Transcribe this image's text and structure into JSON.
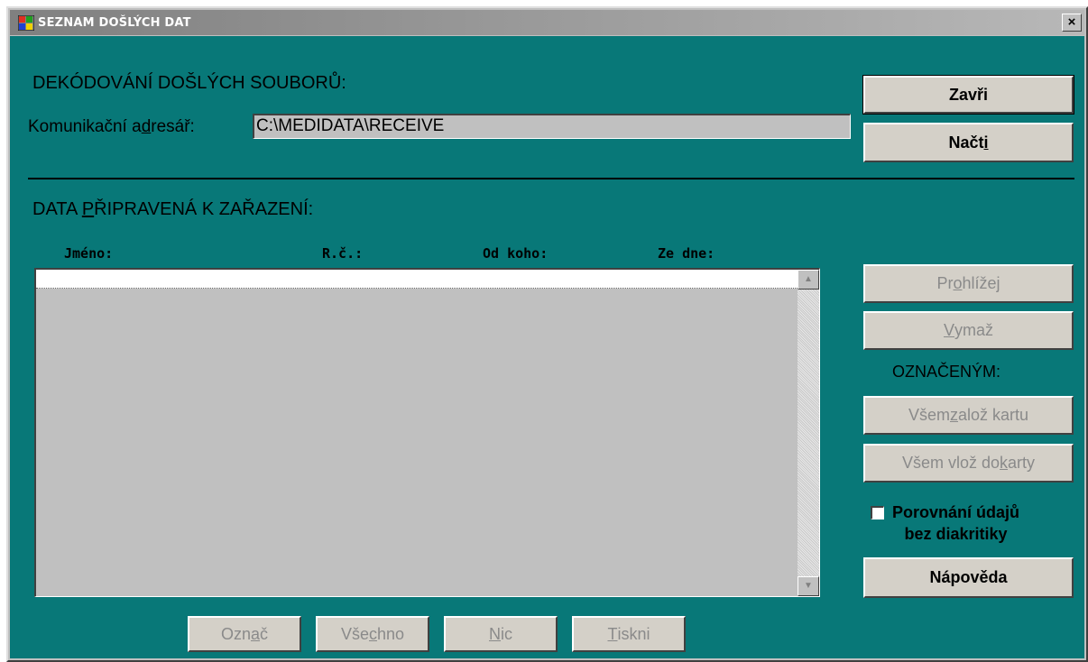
{
  "window": {
    "title": "SEZNAM DOŠLÝCH DAT",
    "close_glyph": "×"
  },
  "decode": {
    "heading": "DEKÓDOVÁNÍ DOŠLÝCH SOUBORŮ:",
    "dir_label_pre": "Komunikační a",
    "dir_label_u": "d",
    "dir_label_post": "resář:",
    "dir_value": "C:\\MEDIDATA\\RECEIVE"
  },
  "ready": {
    "heading_pre": "DATA ",
    "heading_u": "P",
    "heading_post": "ŘIPRAVENÁ K ZAŘAZENÍ:"
  },
  "table": {
    "columns": [
      "Jméno:",
      "R.č.:",
      "Od koho:",
      "Ze dne:"
    ],
    "rows": []
  },
  "buttons": {
    "close": "Zavři",
    "load_pre": "Načt",
    "load_u": "i",
    "view_pre": "Pr",
    "view_u": "o",
    "view_post": "hlížej",
    "delete_u": "V",
    "delete_post": "ymaž",
    "marked_label": "OZNAČENÝM:",
    "create_card_pre": "Všem ",
    "create_card_u": "z",
    "create_card_post": "alož kartu",
    "insert_card_pre": "Všem vlož do ",
    "insert_card_u": "k",
    "insert_card_post": "arty",
    "help": "Nápověda",
    "mark_pre": "Ozn",
    "mark_u": "a",
    "mark_post": "č",
    "all_pre": "Vše",
    "all_u": "c",
    "all_post": "hno",
    "none_u": "N",
    "none_post": "ic",
    "print_u": "T",
    "print_post": "iskni"
  },
  "options": {
    "compare_label_line1": "Porovnání údajů",
    "compare_label_line2": "bez diakritiky",
    "compare_checked": false
  },
  "colors": {
    "client_bg": "#087878",
    "button_face": "#d4d0c8",
    "disabled_text": "#8a8a8a"
  }
}
